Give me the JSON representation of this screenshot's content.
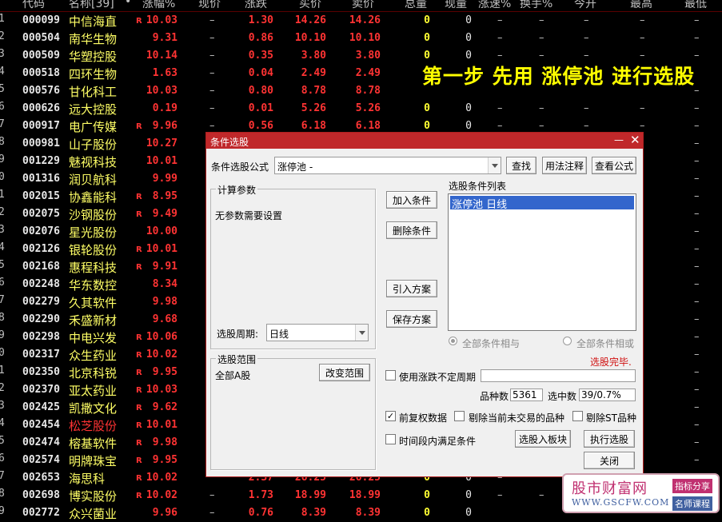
{
  "header": {
    "code": "代码",
    "name": "名称[39]",
    "dot": "•",
    "pct": "涨幅%",
    "xq": "现价",
    "zd": "涨跌",
    "mj": "买价",
    "sj": "卖价",
    "zl": "总量",
    "xl": "现量",
    "zs": "涨速%",
    "hs": "换手%",
    "jk": "今开",
    "zg": "最高",
    "zd2": "最低"
  },
  "rows": [
    {
      "idx": "1",
      "code": "000099",
      "name": "中信海直",
      "r": "R",
      "pct": "10.03",
      "xq": "–",
      "zd": "1.30",
      "mj": "14.26",
      "sj": "14.26",
      "zl": "0",
      "xl": "0",
      "d1": "–",
      "d2": "–",
      "d3": "–",
      "d4": "–",
      "d5": "–"
    },
    {
      "idx": "2",
      "code": "000504",
      "name": "南华生物",
      "r": "",
      "pct": "9.31",
      "xq": "–",
      "zd": "0.86",
      "mj": "10.10",
      "sj": "10.10",
      "zl": "0",
      "xl": "0",
      "d1": "–",
      "d2": "–",
      "d3": "–",
      "d4": "–",
      "d5": "–"
    },
    {
      "idx": "3",
      "code": "000509",
      "name": "华塑控股",
      "r": "",
      "pct": "10.14",
      "xq": "–",
      "zd": "0.35",
      "mj": "3.80",
      "sj": "3.80",
      "zl": "0",
      "xl": "0",
      "d1": "–",
      "d2": "–",
      "d3": "–",
      "d4": "–",
      "d5": "–"
    },
    {
      "idx": "4",
      "code": "000518",
      "name": "四环生物",
      "r": "",
      "pct": "1.63",
      "xq": "–",
      "zd": "0.04",
      "mj": "2.49",
      "sj": "2.49",
      "zl": "",
      "xl": "",
      "d1": "",
      "d2": "",
      "d3": "",
      "d4": "",
      "d5": ""
    },
    {
      "idx": "5",
      "code": "000576",
      "name": "甘化科工",
      "r": "",
      "pct": "10.03",
      "xq": "–",
      "zd": "0.80",
      "mj": "8.78",
      "sj": "8.78",
      "zl": "",
      "xl": "",
      "d1": "",
      "d2": "",
      "d3": "",
      "d4": "",
      "d5": "–"
    },
    {
      "idx": "6",
      "code": "000626",
      "name": "远大控股",
      "r": "",
      "pct": "0.19",
      "xq": "–",
      "zd": "0.01",
      "mj": "5.26",
      "sj": "5.26",
      "zl": "0",
      "xl": "0",
      "d1": "–",
      "d2": "–",
      "d3": "–",
      "d4": "–",
      "d5": "–"
    },
    {
      "idx": "7",
      "code": "000917",
      "name": "电广传媒",
      "r": "R",
      "pct": "9.96",
      "xq": "–",
      "zd": "0.56",
      "mj": "6.18",
      "sj": "6.18",
      "zl": "0",
      "xl": "0",
      "d1": "–",
      "d2": "–",
      "d3": "–",
      "d4": "–",
      "d5": "–"
    },
    {
      "idx": "8",
      "code": "000981",
      "name": "山子股份",
      "r": "",
      "pct": "10.27",
      "xq": "",
      "zd": "",
      "mj": "",
      "sj": "",
      "zl": "",
      "xl": "",
      "d1": "",
      "d2": "",
      "d3": "",
      "d4": "",
      "d5": "–"
    },
    {
      "idx": "9",
      "code": "001229",
      "name": "魅视科技",
      "r": "",
      "pct": "10.01",
      "xq": "",
      "zd": "",
      "mj": "",
      "sj": "",
      "zl": "",
      "xl": "",
      "d1": "",
      "d2": "",
      "d3": "",
      "d4": "",
      "d5": "–"
    },
    {
      "idx": "0",
      "code": "001316",
      "name": "润贝航科",
      "r": "",
      "pct": "9.99",
      "xq": "",
      "zd": "",
      "mj": "",
      "sj": "",
      "zl": "",
      "xl": "",
      "d1": "",
      "d2": "",
      "d3": "",
      "d4": "",
      "d5": "–"
    },
    {
      "idx": "1",
      "code": "002015",
      "name": "协鑫能科",
      "r": "R",
      "pct": "8.95",
      "xq": "",
      "zd": "",
      "mj": "",
      "sj": "",
      "zl": "",
      "xl": "",
      "d1": "",
      "d2": "",
      "d3": "",
      "d4": "",
      "d5": "–"
    },
    {
      "idx": "2",
      "code": "002075",
      "name": "沙钢股份",
      "r": "R",
      "pct": "9.49",
      "xq": "",
      "zd": "",
      "mj": "",
      "sj": "",
      "zl": "",
      "xl": "",
      "d1": "",
      "d2": "",
      "d3": "",
      "d4": "",
      "d5": "–"
    },
    {
      "idx": "3",
      "code": "002076",
      "name": "星光股份",
      "r": "",
      "pct": "10.00",
      "xq": "",
      "zd": "",
      "mj": "",
      "sj": "",
      "zl": "",
      "xl": "",
      "d1": "",
      "d2": "",
      "d3": "",
      "d4": "",
      "d5": "–"
    },
    {
      "idx": "4",
      "code": "002126",
      "name": "银轮股份",
      "r": "R",
      "pct": "10.01",
      "xq": "",
      "zd": "",
      "mj": "",
      "sj": "",
      "zl": "",
      "xl": "",
      "d1": "",
      "d2": "",
      "d3": "",
      "d4": "",
      "d5": "–"
    },
    {
      "idx": "5",
      "code": "002168",
      "name": "惠程科技",
      "r": "R",
      "pct": "9.91",
      "xq": "",
      "zd": "",
      "mj": "",
      "sj": "",
      "zl": "",
      "xl": "",
      "d1": "",
      "d2": "",
      "d3": "",
      "d4": "",
      "d5": "–"
    },
    {
      "idx": "6",
      "code": "002248",
      "name": "华东数控",
      "r": "",
      "pct": "8.34",
      "xq": "",
      "zd": "",
      "mj": "",
      "sj": "",
      "zl": "",
      "xl": "",
      "d1": "",
      "d2": "",
      "d3": "",
      "d4": "",
      "d5": "–"
    },
    {
      "idx": "7",
      "code": "002279",
      "name": "久其软件",
      "r": "",
      "pct": "9.98",
      "xq": "",
      "zd": "",
      "mj": "",
      "sj": "",
      "zl": "",
      "xl": "",
      "d1": "",
      "d2": "",
      "d3": "",
      "d4": "",
      "d5": "–"
    },
    {
      "idx": "8",
      "code": "002290",
      "name": "禾盛新材",
      "r": "",
      "pct": "9.68",
      "xq": "",
      "zd": "",
      "mj": "",
      "sj": "",
      "zl": "",
      "xl": "",
      "d1": "",
      "d2": "",
      "d3": "",
      "d4": "",
      "d5": "–"
    },
    {
      "idx": "9",
      "code": "002298",
      "name": "中电兴发",
      "r": "R",
      "pct": "10.06",
      "xq": "",
      "zd": "",
      "mj": "",
      "sj": "",
      "zl": "",
      "xl": "",
      "d1": "",
      "d2": "",
      "d3": "",
      "d4": "",
      "d5": "–"
    },
    {
      "idx": "0",
      "code": "002317",
      "name": "众生药业",
      "r": "R",
      "pct": "10.02",
      "xq": "",
      "zd": "",
      "mj": "",
      "sj": "",
      "zl": "",
      "xl": "",
      "d1": "",
      "d2": "",
      "d3": "",
      "d4": "",
      "d5": "–"
    },
    {
      "idx": "1",
      "code": "002350",
      "name": "北京科锐",
      "r": "R",
      "pct": "9.95",
      "xq": "",
      "zd": "",
      "mj": "",
      "sj": "",
      "zl": "",
      "xl": "",
      "d1": "",
      "d2": "",
      "d3": "",
      "d4": "",
      "d5": "–"
    },
    {
      "idx": "2",
      "code": "002370",
      "name": "亚太药业",
      "r": "R",
      "pct": "10.03",
      "xq": "",
      "zd": "",
      "mj": "",
      "sj": "",
      "zl": "",
      "xl": "",
      "d1": "",
      "d2": "",
      "d3": "",
      "d4": "",
      "d5": "–"
    },
    {
      "idx": "3",
      "code": "002425",
      "name": "凯撒文化",
      "r": "R",
      "pct": "9.62",
      "xq": "",
      "zd": "",
      "mj": "",
      "sj": "",
      "zl": "",
      "xl": "",
      "d1": "",
      "d2": "",
      "d3": "",
      "d4": "",
      "d5": "–"
    },
    {
      "idx": "4",
      "code": "002454",
      "name": "松芝股份",
      "r": "R",
      "pct": "10.01",
      "xq": "",
      "zd": "",
      "mj": "",
      "sj": "",
      "zl": "",
      "xl": "",
      "d1": "",
      "d2": "",
      "d3": "",
      "d4": "",
      "d5": "–",
      "red": true
    },
    {
      "idx": "5",
      "code": "002474",
      "name": "榕基软件",
      "r": "R",
      "pct": "9.98",
      "xq": "",
      "zd": "",
      "mj": "",
      "sj": "",
      "zl": "",
      "xl": "",
      "d1": "",
      "d2": "",
      "d3": "",
      "d4": "",
      "d5": "–"
    },
    {
      "idx": "6",
      "code": "002574",
      "name": "明牌珠宝",
      "r": "R",
      "pct": "9.95",
      "xq": "",
      "zd": "",
      "mj": "",
      "sj": "",
      "zl": "",
      "xl": "",
      "d1": "",
      "d2": "",
      "d3": "",
      "d4": "",
      "d5": "–"
    },
    {
      "idx": "7",
      "code": "002653",
      "name": "海思科",
      "r": "R",
      "pct": "10.02",
      "xq": "",
      "zd": "2.37",
      "mj": "26.25",
      "sj": "26.25",
      "zl": "0",
      "xl": "0",
      "d1": "–",
      "d2": "",
      "d3": "",
      "d4": "",
      "d5": ""
    },
    {
      "idx": "8",
      "code": "002698",
      "name": "博实股份",
      "r": "R",
      "pct": "10.02",
      "xq": "–",
      "zd": "1.73",
      "mj": "18.99",
      "sj": "18.99",
      "zl": "0",
      "xl": "0",
      "d1": "–",
      "d2": "–",
      "d3": "",
      "d4": "",
      "d5": ""
    },
    {
      "idx": "9",
      "code": "002772",
      "name": "众兴菌业",
      "r": "",
      "pct": "9.96",
      "xq": "–",
      "zd": "0.76",
      "mj": "8.39",
      "sj": "8.39",
      "zl": "0",
      "xl": "0",
      "d1": "",
      "d2": "",
      "d3": "",
      "d4": "",
      "d5": ""
    }
  ],
  "banner": "第一步 先用 涨停池 进行选股",
  "dialog": {
    "title": "条件选股",
    "formula_label": "条件选股公式",
    "formula_value": "涨停池        -",
    "find_btn": "查找",
    "usage_btn": "用法注释",
    "view_formula_btn": "查看公式",
    "params_group": "计算参数",
    "no_params": "无参数需要设置",
    "add_btn": "加入条件",
    "del_btn": "删除条件",
    "import_btn": "引入方案",
    "save_btn": "保存方案",
    "cond_list_label": "选股条件列表",
    "cond_items": [
      "涨停池  日线"
    ],
    "period_label": "选股周期:",
    "period_value": "日线",
    "radio_and": "全部条件相与",
    "radio_or": "全部条件相或",
    "done_text": "选股完毕.",
    "range_group": "选股范围",
    "range_value": "全部A股",
    "change_range_btn": "改变范围",
    "indef_period_label": "使用涨跌不定周期",
    "count_label": "品种数",
    "count_value": "5361",
    "selected_label": "选中数",
    "selected_value": "39/0.7%",
    "fq_label": "前复权数据",
    "exclude_untraded_label": "剔除当前未交易的品种",
    "exclude_st_label": "剔除ST品种",
    "time_range_label": "时间段内满足条件",
    "to_block_btn": "选股入板块",
    "execute_btn": "执行选股",
    "close_btn": "关闭",
    "done_color": "#d01010"
  },
  "watermark": {
    "brand": "股市财富网",
    "url": "WWW.GSCFW.COM",
    "tag1": "指标分享",
    "tag2": "名师课程"
  }
}
